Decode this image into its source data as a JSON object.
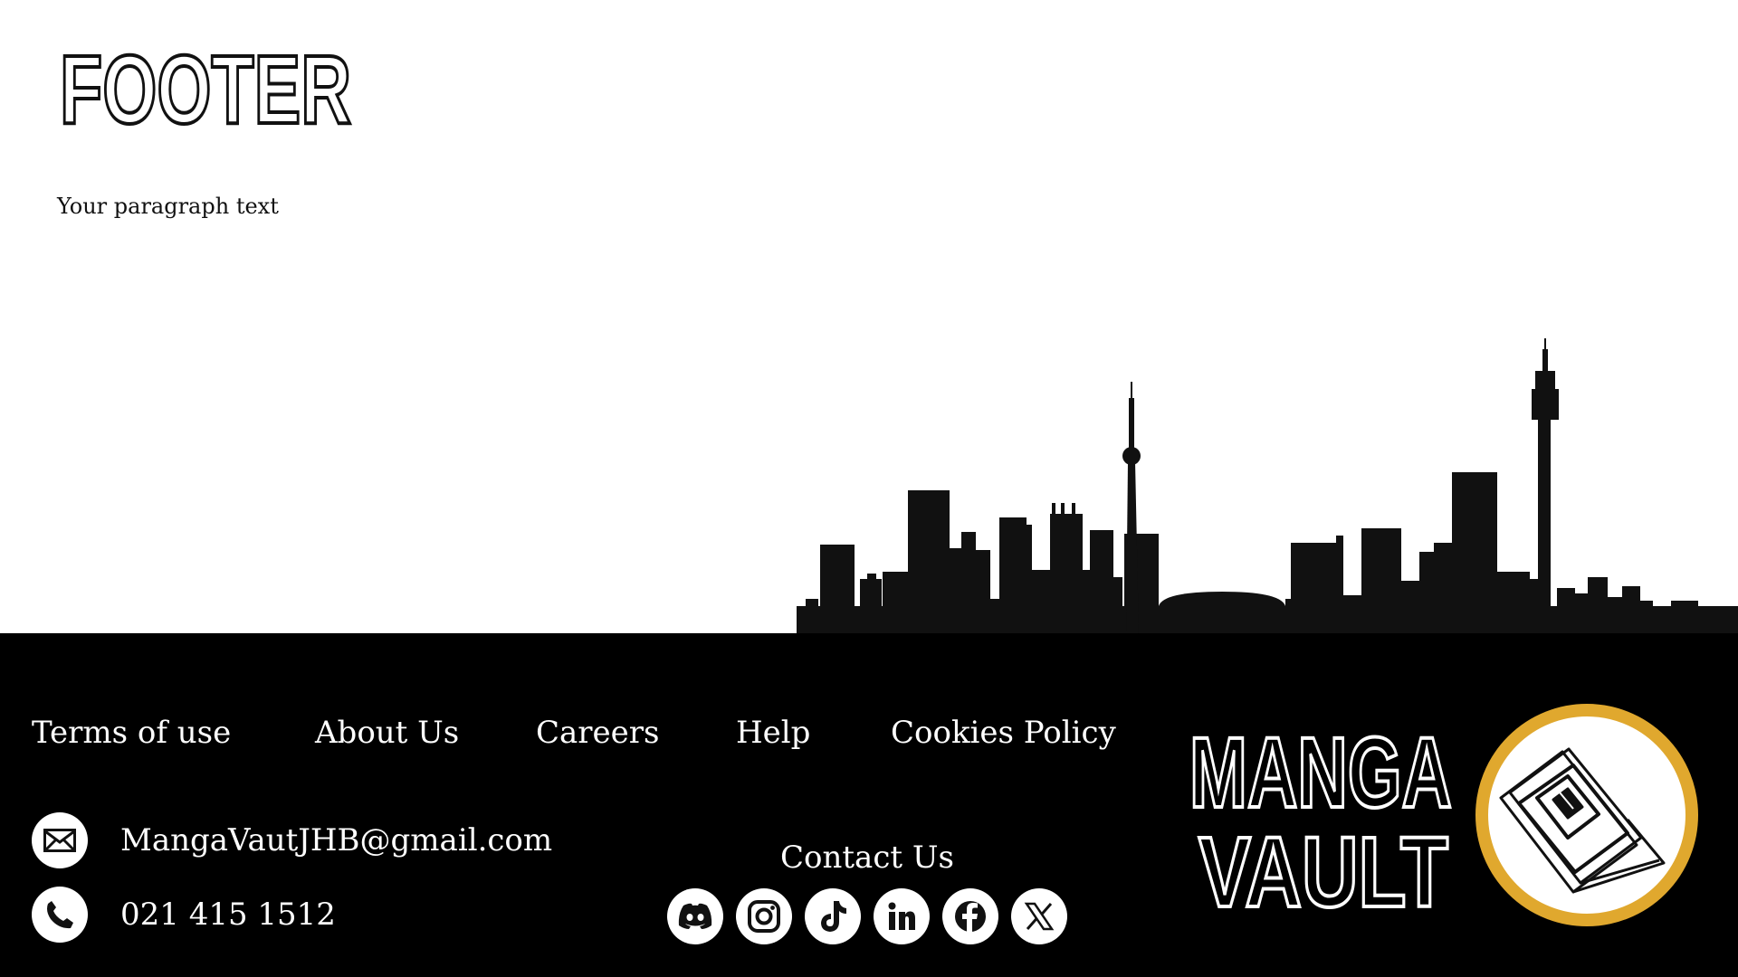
{
  "header": {
    "title": "FOOTER",
    "paragraph": "Your paragraph text"
  },
  "footer": {
    "nav": [
      {
        "label": "Terms of use"
      },
      {
        "label": "About Us"
      },
      {
        "label": "Careers"
      },
      {
        "label": "Help"
      },
      {
        "label": "Cookies Policy"
      }
    ],
    "contact": {
      "email": "MangaVautJHB@gmail.com",
      "phone": "021 415 1512",
      "heading": "Contact Us"
    },
    "socials": [
      {
        "icon": "discord-icon"
      },
      {
        "icon": "instagram-icon"
      },
      {
        "icon": "tiktok-icon"
      },
      {
        "icon": "linkedin-icon"
      },
      {
        "icon": "facebook-icon"
      },
      {
        "icon": "x-icon"
      }
    ],
    "logo": {
      "line1": "MANGA",
      "line2": "VAULT"
    }
  },
  "colors": {
    "footer_bg": "#000000",
    "text": "#ffffff",
    "badge_ring": "#e0a82e"
  }
}
